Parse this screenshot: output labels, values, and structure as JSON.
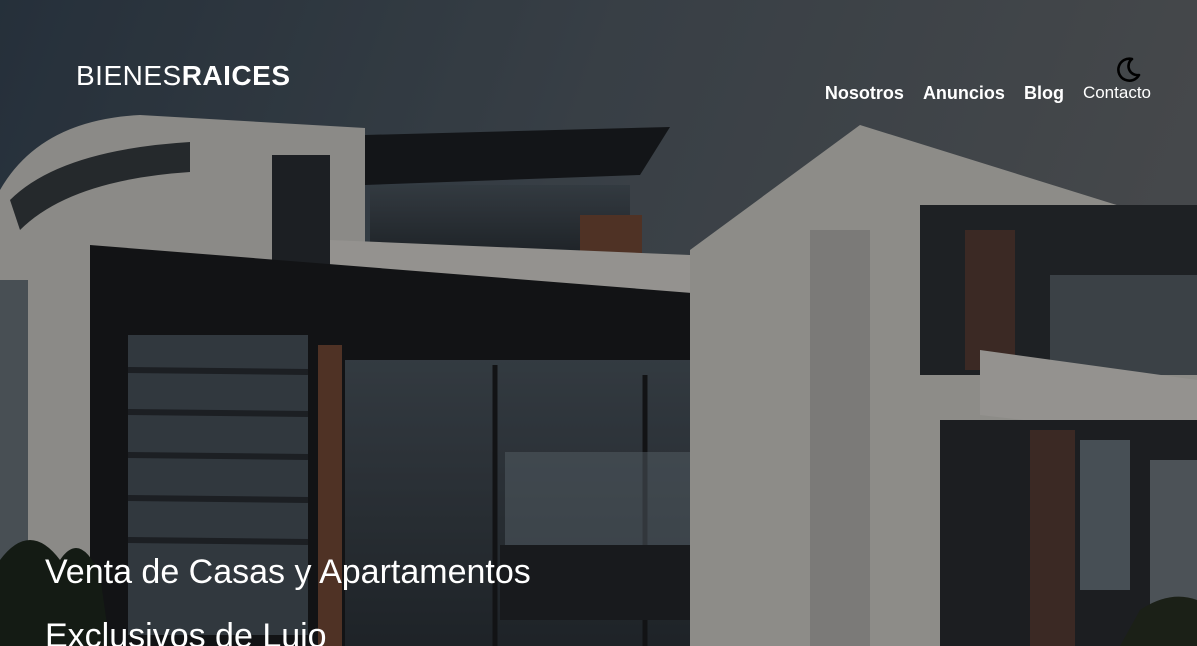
{
  "header": {
    "logo_light": "BIENES",
    "logo_bold": "RAICES",
    "dark_mode_icon": "moon-icon"
  },
  "nav": {
    "items": [
      {
        "label": "Nosotros"
      },
      {
        "label": "Anuncios"
      },
      {
        "label": "Blog"
      },
      {
        "label": "Contacto"
      }
    ]
  },
  "hero": {
    "headline_line1": "Venta de Casas y Apartamentos",
    "headline_line2": "Exclusivos de Lujo",
    "background_image": "modern-house-photo"
  },
  "colors": {
    "text": "#ffffff",
    "overlay": "#000000"
  }
}
